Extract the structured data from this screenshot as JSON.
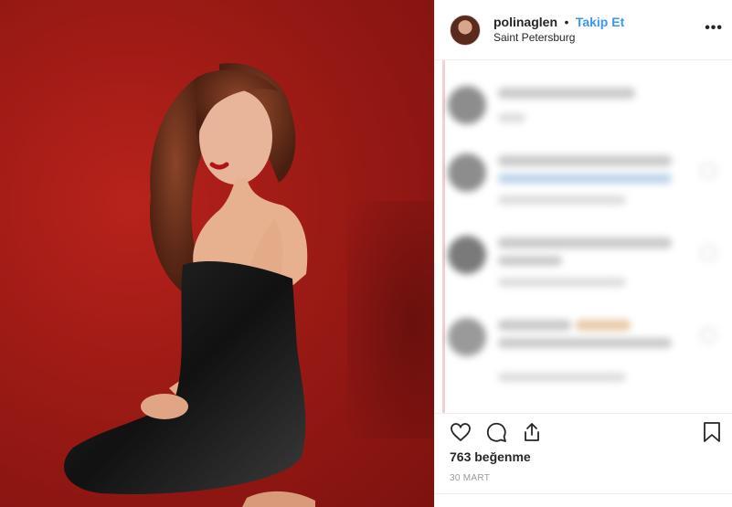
{
  "post": {
    "username": "polinaglen",
    "separator": "•",
    "follow_label": "Takip Et",
    "location": "Saint Petersburg",
    "more_label": "•••",
    "likes": "763 beğenme",
    "date": "30 MART"
  },
  "icons": {
    "like": "heart-icon",
    "comment": "comment-icon",
    "share": "share-icon",
    "save": "bookmark-icon"
  },
  "colors": {
    "follow": "#3897f0",
    "photo_background": "#9c1a15"
  }
}
